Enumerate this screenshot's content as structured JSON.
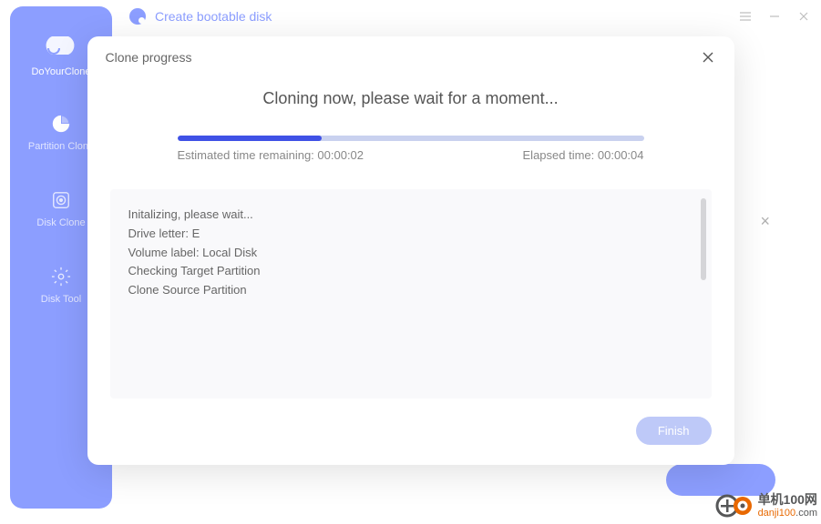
{
  "topbar": {
    "title": "Create bootable disk"
  },
  "sidebar": {
    "app_name": "DoYourClone",
    "items": [
      {
        "label": "Partition Clone"
      },
      {
        "label": "Disk Clone"
      },
      {
        "label": "Disk Tool"
      }
    ]
  },
  "modal": {
    "title": "Clone progress",
    "status": "Cloning now, please wait for a moment...",
    "estimated_label": "Estimated time remaining: ",
    "estimated_value": "00:00:02",
    "elapsed_label": "Elapsed time: ",
    "elapsed_value": "00:00:04",
    "progress_percent": 31,
    "log_lines": [
      "Initalizing, please wait...",
      "Drive letter: E",
      "Volume label: Local Disk",
      "Checking Target Partition",
      "Clone Source Partition"
    ],
    "finish_label": "Finish"
  },
  "watermark": {
    "cn": "单机100网",
    "url_prefix": "danji100",
    "url_suffix": ".com"
  }
}
